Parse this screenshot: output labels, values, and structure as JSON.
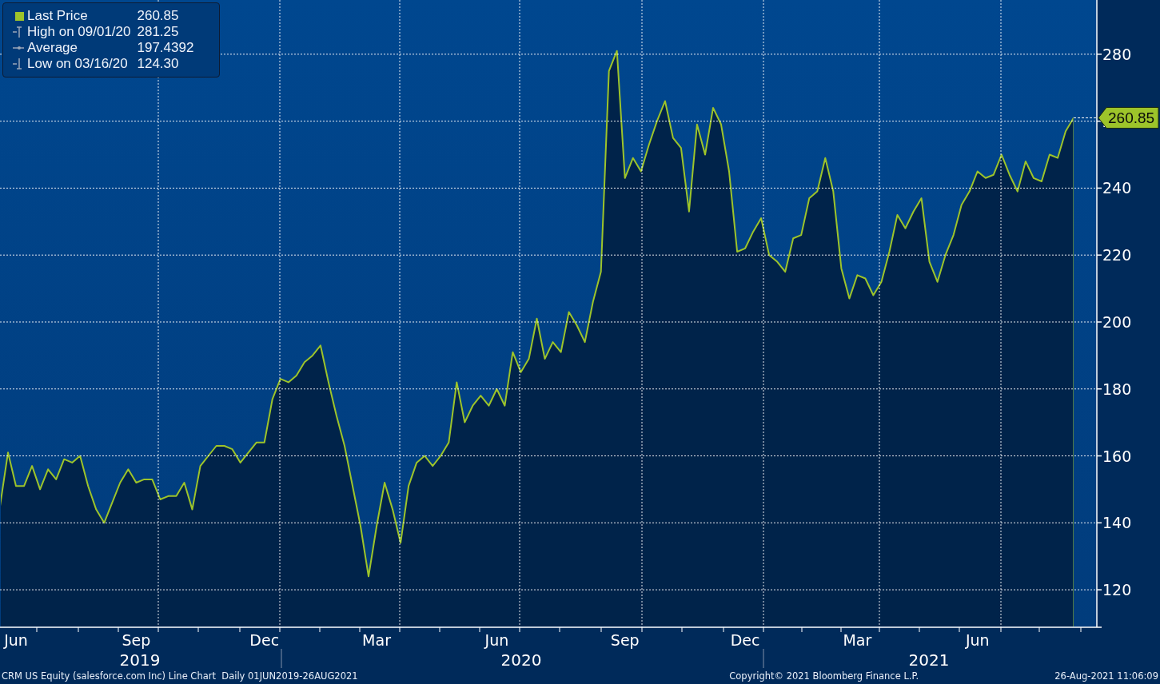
{
  "legend": {
    "items": [
      {
        "kind": "swatch",
        "value": "260.85",
        "color": "#9dc42a"
      },
      {
        "kind": "high",
        "label": "High on 09/01/20",
        "value": "281.25"
      },
      {
        "kind": "average",
        "label": "Average",
        "value": "197.4392"
      },
      {
        "kind": "low",
        "label": "Low on 03/16/20",
        "value": "124.30"
      }
    ]
  },
  "chart": {
    "last_price_tag": "260.85",
    "year_labels": [
      "2019",
      "2020",
      "2021"
    ],
    "chart_data": {
      "type": "area",
      "grid": true,
      "ylim": [
        108.8,
        296.2
      ],
      "yticks": [
        120,
        140,
        160,
        180,
        200,
        220,
        240,
        260,
        280
      ],
      "categories": [
        null,
        null,
        "Jun",
        null,
        null,
        null,
        null,
        null,
        null,
        null,
        null,
        null,
        null,
        null,
        null,
        null,
        null,
        "Sep",
        null,
        null,
        null,
        null,
        null,
        null,
        null,
        null,
        null,
        null,
        null,
        null,
        null,
        null,
        null,
        "Dec",
        null,
        null,
        null,
        null,
        null,
        null,
        null,
        null,
        null,
        null,
        null,
        null,
        null,
        "Mar",
        null,
        null,
        null,
        null,
        null,
        null,
        null,
        null,
        null,
        null,
        null,
        null,
        null,
        null,
        "Jun",
        null,
        null,
        null,
        null,
        null,
        null,
        null,
        null,
        null,
        null,
        null,
        null,
        null,
        null,
        null,
        "Sep",
        null,
        null,
        null,
        null,
        null,
        null,
        null,
        null,
        null,
        null,
        null,
        null,
        null,
        null,
        "Dec",
        null,
        null,
        null,
        null,
        null,
        null,
        null,
        null,
        null,
        null,
        null,
        null,
        null,
        "Mar",
        null,
        null,
        null,
        null,
        null,
        null,
        null,
        null,
        null,
        null,
        null,
        null,
        null,
        null,
        "Jun",
        null,
        null,
        null,
        null,
        null,
        null,
        null,
        null,
        null,
        null,
        null,
        null
      ],
      "series": [
        {
          "name": "Last Price",
          "color": "#9dc42a",
          "values": [
            145,
            161,
            151,
            151,
            157,
            150,
            156,
            153,
            159,
            158,
            160,
            151,
            144,
            140,
            146,
            152,
            156,
            152,
            153,
            153,
            147,
            148,
            148,
            152,
            144,
            157,
            160,
            163,
            163,
            162,
            158,
            161,
            164,
            164,
            177,
            183,
            182,
            184,
            188,
            190,
            193,
            182,
            172,
            163,
            151,
            139,
            124,
            139,
            152,
            144,
            134,
            151,
            158,
            160,
            157,
            160,
            164,
            182,
            170,
            175,
            178,
            175,
            180,
            175,
            191,
            185,
            189,
            201,
            189,
            194,
            191,
            203,
            199,
            194,
            206,
            215,
            275,
            281,
            243,
            249,
            245,
            253,
            260,
            266,
            255,
            252,
            233,
            259,
            250,
            264,
            259,
            245,
            221,
            222,
            227,
            231,
            220,
            218,
            215,
            225,
            226,
            237,
            239,
            249,
            239,
            216,
            207,
            214,
            213,
            208,
            212,
            221,
            232,
            228,
            233,
            237,
            218,
            212,
            220,
            226,
            235,
            239,
            245,
            243,
            244,
            250,
            244,
            239,
            248,
            243,
            242,
            250,
            249,
            257,
            261
          ]
        }
      ]
    }
  },
  "footer": {
    "description": "CRM US Equity (salesforce.com Inc) Line Chart  Daily 01JUN2019-26AUG2021",
    "copyright": "Copyright© 2021 Bloomberg Finance L.P.",
    "timestamp": "26-Aug-2021 11:06:09"
  }
}
